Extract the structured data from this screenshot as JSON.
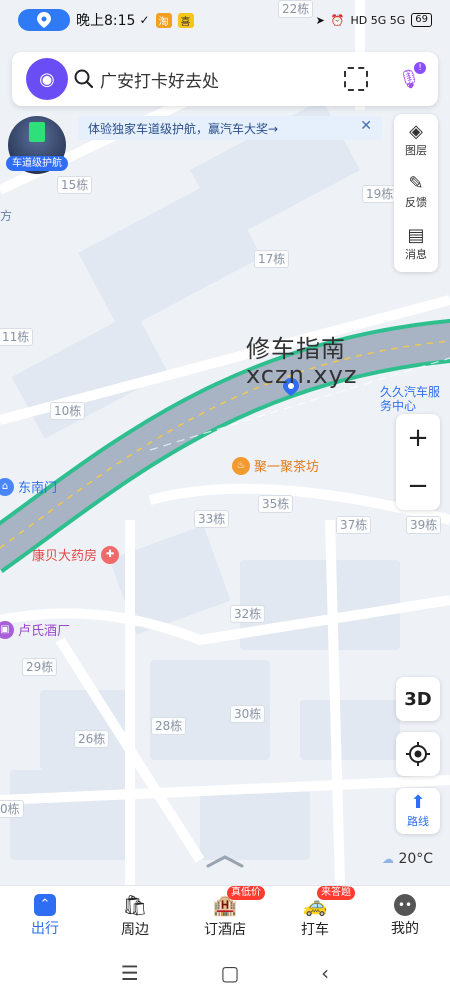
{
  "status_bar": {
    "time": "晚上8:15",
    "app_icons": [
      "淘",
      "喜"
    ],
    "network": "HD 5G 5G",
    "battery": "69"
  },
  "search": {
    "placeholder": "广安打卡好去处",
    "mic_badge": "!"
  },
  "lane_nav": {
    "label": "车道级护航"
  },
  "promo": {
    "text": "体验独家车道级护航，赢汽车大奖→",
    "close": "✕"
  },
  "tools": [
    {
      "label": "图层",
      "icon": "layers-icon"
    },
    {
      "label": "反馈",
      "icon": "feedback-icon"
    },
    {
      "label": "消息",
      "icon": "message-icon"
    }
  ],
  "zoom": {
    "in": "+",
    "out": "−"
  },
  "buttons": {
    "three_d": "3D",
    "route": "路线"
  },
  "watermark": {
    "line1": "修车指南",
    "line2": "xczn.xyz"
  },
  "buildings": [
    "22栋",
    "15栋",
    "19栋",
    "17栋",
    "11栋",
    "10栋",
    "33栋",
    "35栋",
    "37栋",
    "39栋",
    "32栋",
    "29栋",
    "28栋",
    "30栋",
    "26栋",
    "0栋",
    "方"
  ],
  "pois": {
    "tea": "聚一聚茶坊",
    "pharmacy": "康贝大药房",
    "east_gate": "东南门",
    "winery": "卢氏酒厂",
    "car_service": "久久汽车服务中心"
  },
  "weather": {
    "temp": "20°C"
  },
  "bottom_nav": [
    {
      "label": "出行",
      "active": true
    },
    {
      "label": "周边",
      "active": false
    },
    {
      "label": "订酒店",
      "tag": "真低价",
      "active": false
    },
    {
      "label": "打车",
      "tag": "来答题",
      "active": false
    },
    {
      "label": "我的",
      "active": false
    }
  ],
  "colors": {
    "accent": "#2f6ef2",
    "road_outline": "#2fbf8f",
    "road_fill": "#a8b3c4"
  }
}
